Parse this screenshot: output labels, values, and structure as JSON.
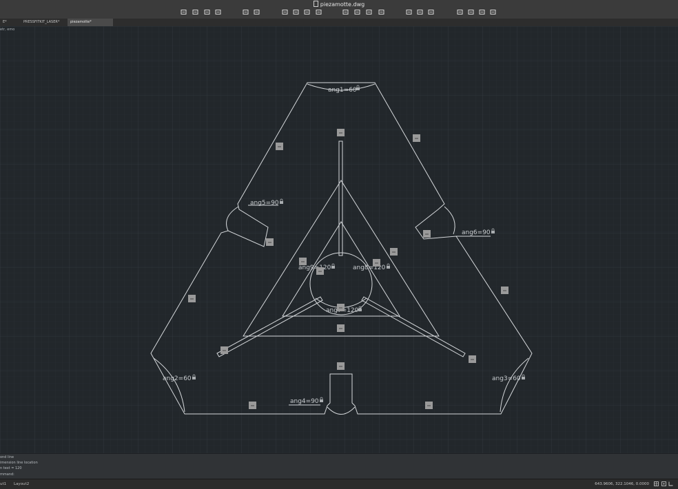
{
  "window": {
    "title": "piezamotte.dwg"
  },
  "toolbar": {
    "icons": [
      "new-icon",
      "open-icon",
      "save-icon",
      "save-as-icon",
      "undo-icon",
      "redo-icon",
      "plot-icon",
      "plot-preview-icon",
      "copy-icon",
      "paste-icon",
      "properties-icon",
      "layer-icon",
      "block-icon",
      "insert-icon",
      "select-icon",
      "pan-icon",
      "orbit-icon",
      "view-icon",
      "cube-icon",
      "render-icon",
      "expand-icon"
    ]
  },
  "tabs": [
    {
      "label": "E*"
    },
    {
      "label": "PRESSFITKIT_LASER*"
    },
    {
      "label": "piezamotte*"
    }
  ],
  "viewport": {
    "label": "etr, emo"
  },
  "dimensions": [
    {
      "text": "ang1=60"
    },
    {
      "text": "ang2=60"
    },
    {
      "text": "ang3=60"
    },
    {
      "text": "ang4=90"
    },
    {
      "text": "ang5=90"
    },
    {
      "text": "ang6=90"
    },
    {
      "text": "ang7=120"
    },
    {
      "text": "ang8=120"
    },
    {
      "text": "ang9=120"
    }
  ],
  "command": {
    "lines": [
      "ond line",
      "imension line location",
      "n text = 120",
      "mmand:"
    ]
  },
  "status": {
    "layouts": [
      "ut1",
      "Layout2"
    ],
    "coordinates": "643.9606, 322.1046, 0.0000"
  },
  "colors": {
    "background": "#22272b",
    "grid_minor": "#2a3035",
    "grid_major": "#30373c",
    "geometry": "#d6d9dc",
    "constraint_icon": "#9a9a9a"
  }
}
